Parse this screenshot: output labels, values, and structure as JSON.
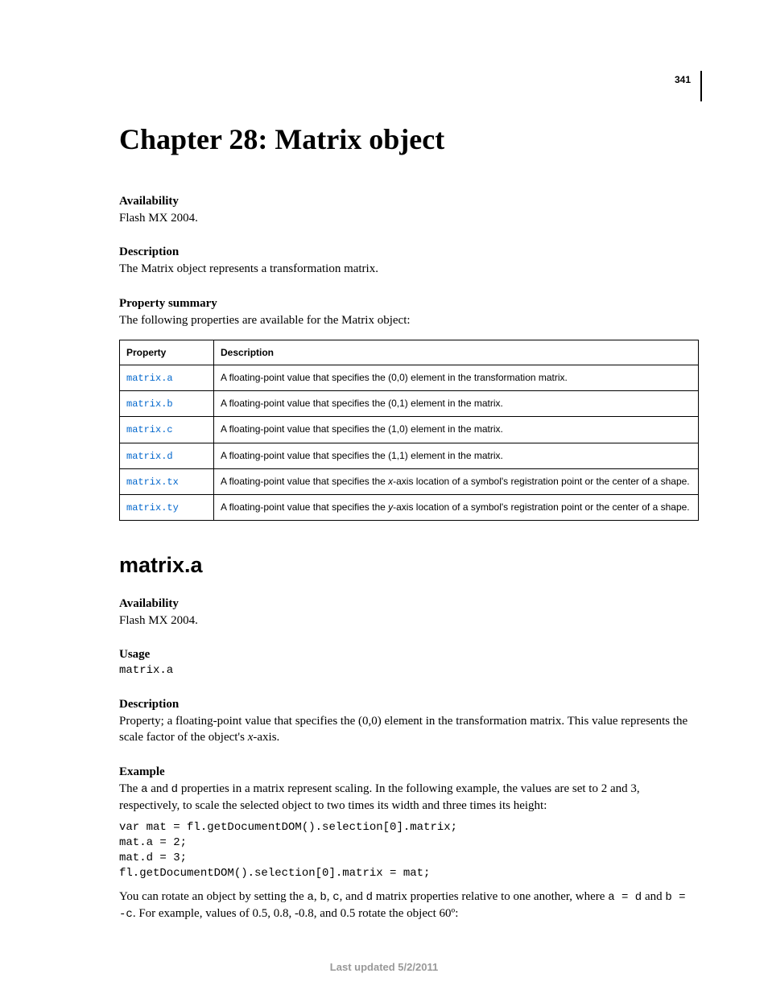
{
  "page_number": "341",
  "chapter_title": "Chapter 28: Matrix object",
  "sec1": {
    "availability_h": "Availability",
    "availability_t": "Flash MX 2004.",
    "description_h": "Description",
    "description_t": "The Matrix object represents a transformation matrix.",
    "summary_h": "Property summary",
    "summary_t": "The following properties are available for the Matrix object:"
  },
  "table": {
    "h_prop": "Property",
    "h_desc": "Description",
    "rows": [
      {
        "p": "matrix.a",
        "d": "A floating-point value that specifies the (0,0) element in the transformation matrix."
      },
      {
        "p": "matrix.b",
        "d": "A floating-point value that specifies the (0,1) element in the matrix."
      },
      {
        "p": "matrix.c",
        "d": "A floating-point value that specifies the (1,0) element in the matrix."
      },
      {
        "p": "matrix.d",
        "d": "A floating-point value that specifies the (1,1) element in the matrix."
      },
      {
        "p": "matrix.tx",
        "d_pre": "A floating-point value that specifies the ",
        "d_i": "x",
        "d_post": "-axis location of a symbol's registration point or the center of a shape."
      },
      {
        "p": "matrix.ty",
        "d_pre": "A floating-point value that specifies the ",
        "d_i": "y",
        "d_post": "-axis location of a symbol's registration point or the center of a shape."
      }
    ]
  },
  "member": {
    "title": "matrix.a",
    "availability_h": "Availability",
    "availability_t": "Flash MX 2004.",
    "usage_h": "Usage",
    "usage_code": "matrix.a",
    "description_h": "Description",
    "desc_parts": {
      "pre": "Property; a floating-point value that specifies the (0,0) element in the transformation matrix. This value represents the scale factor of the object's ",
      "i": "x",
      "post": "-axis."
    },
    "example_h": "Example",
    "ex_p1": {
      "a": "The ",
      "c1": "a",
      "b": " and ",
      "c2": "d",
      "c": " properties in a matrix represent scaling. In the following example, the values are set to 2 and 3, respectively, to scale the selected object to two times its width and three times its height:"
    },
    "ex_code": "var mat = fl.getDocumentDOM().selection[0].matrix;\nmat.a = 2;\nmat.d = 3;\nfl.getDocumentDOM().selection[0].matrix = mat;",
    "ex_p2": {
      "a": "You can rotate an object by setting the ",
      "c1": "a",
      "s1": ", ",
      "c2": "b",
      "s2": ", ",
      "c3": "c",
      "s3": ", and ",
      "c4": "d",
      "b": " matrix properties relative to one another, where ",
      "c5": "a = d",
      "s4": " and ",
      "c6": "b = -c",
      "c": ". For example, values of 0.5, 0.8, -0.8, and 0.5 rotate the object 60º:"
    }
  },
  "footer": "Last updated 5/2/2011"
}
